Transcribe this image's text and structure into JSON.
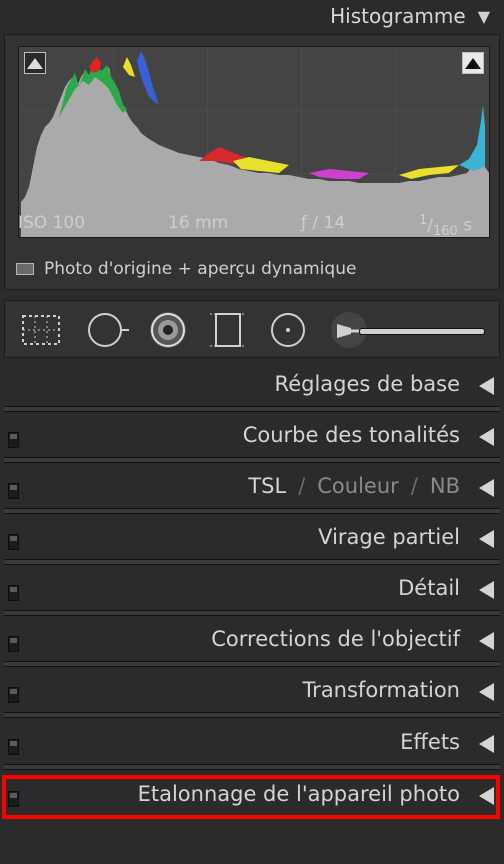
{
  "histogram": {
    "title": "Histogramme",
    "exif": {
      "iso": "ISO 100",
      "focal": "16 mm",
      "aperture": "ƒ / 14",
      "shutter_num": "1",
      "shutter_den": "160",
      "shutter_unit": "s"
    },
    "preview_label": "Photo d'origine + aperçu dynamique"
  },
  "tools": [
    "crop-overlay-icon",
    "spot-removal-icon",
    "red-eye-icon",
    "graduated-filter-icon",
    "radial-filter-icon",
    "adjustment-brush-icon"
  ],
  "panels": [
    {
      "label": "Réglages de base"
    },
    {
      "label": "Courbe des tonalités"
    },
    {
      "tsl": "TSL",
      "slash": "/",
      "couleur": "Couleur",
      "nb": "NB"
    },
    {
      "label": "Virage partiel"
    },
    {
      "label": "Détail"
    },
    {
      "label": "Corrections de l'objectif"
    },
    {
      "label": "Transformation"
    },
    {
      "label": "Effets"
    },
    {
      "label": "Etalonnage de l'appareil photo"
    }
  ],
  "colors": {
    "highlight": "#ff0000",
    "panel_bg": "#2b2b2b"
  }
}
